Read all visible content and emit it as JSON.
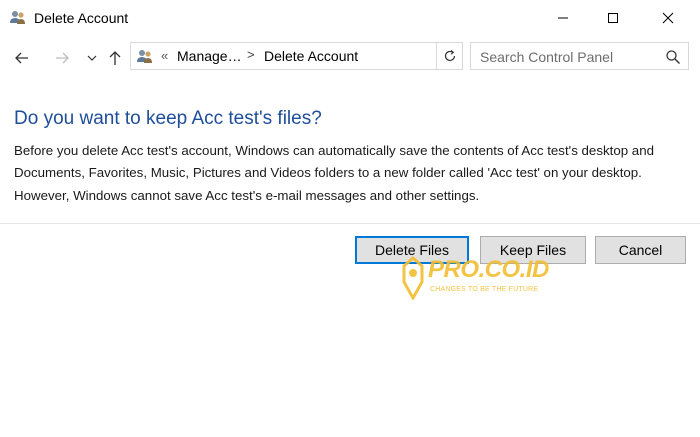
{
  "window": {
    "title": "Delete Account",
    "icon": "users-icon",
    "controls": [
      "minimize-icon",
      "maximize-icon",
      "close-icon"
    ]
  },
  "address_bar": {
    "nav": [
      "back-arrow-icon",
      "forward-arrow-icon",
      "recent-locations-icon",
      "up-arrow-icon"
    ],
    "breadcrumb": {
      "prefix": "«",
      "segments": [
        "Manage…",
        "Delete Account"
      ],
      "separator": ">"
    },
    "search_placeholder": "Search Control Panel"
  },
  "main": {
    "heading": "Do you want to keep Acc test's files?",
    "body": "Before you delete Acc test's account, Windows can automatically save the contents of Acc test's desktop and Documents, Favorites, Music, Pictures and Videos folders to a new folder called 'Acc test' on your desktop. However, Windows cannot save Acc test's e-mail messages and other settings."
  },
  "buttons": {
    "delete_files": "Delete Files",
    "keep_files": "Keep Files",
    "cancel": "Cancel"
  },
  "watermark": {
    "title": "PRO.CO.ID",
    "tagline": "CHANGES TO BE THE FUTURE"
  },
  "colors": {
    "heading": "#1e4e9a",
    "focus_border": "#0078d7",
    "button_bg": "#e1e1e1",
    "watermark": "#f2bd30"
  }
}
